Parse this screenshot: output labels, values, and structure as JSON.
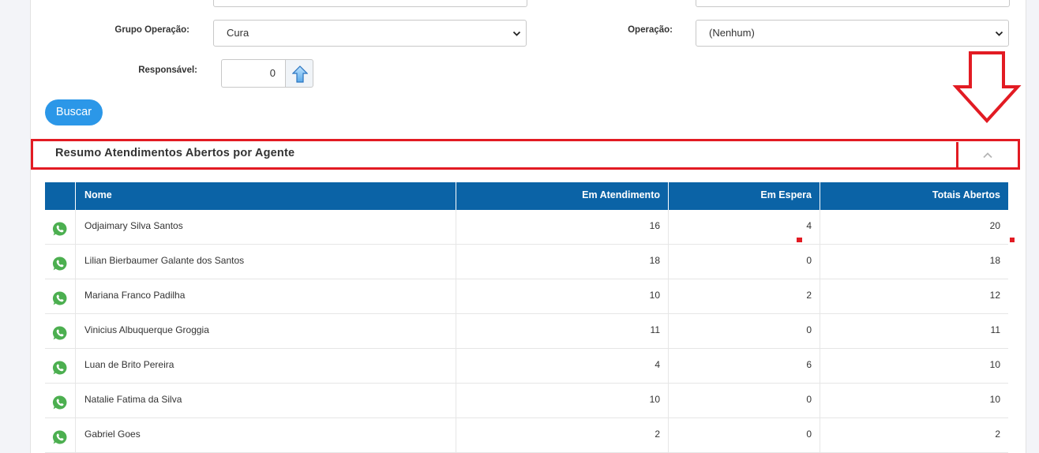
{
  "form": {
    "grupo_operacao": {
      "label": "Grupo Operação:",
      "value": "Cura"
    },
    "operacao": {
      "label": "Operação:",
      "value": "(Nenhum)"
    },
    "responsavel": {
      "label": "Responsável:",
      "value": "0"
    },
    "search_button": "Buscar"
  },
  "panel": {
    "title": "Resumo Atendimentos Abertos por Agente"
  },
  "colors": {
    "header_blue": "#0b63a6",
    "button_blue": "#2b97e8",
    "highlight_red": "#e21b23",
    "whatsapp_green": "#4caf50"
  },
  "table": {
    "headers": [
      "Nome",
      "Em Atendimento",
      "Em Espera",
      "Totais Abertos"
    ],
    "rows": [
      {
        "nome": "Odjaimary Silva Santos",
        "em_atendimento": "16",
        "em_espera": "4",
        "totais": "20"
      },
      {
        "nome": "Lilian Bierbaumer Galante dos Santos",
        "em_atendimento": "18",
        "em_espera": "0",
        "totais": "18"
      },
      {
        "nome": "Mariana Franco Padilha",
        "em_atendimento": "10",
        "em_espera": "2",
        "totais": "12"
      },
      {
        "nome": "Vinicius Albuquerque Groggia",
        "em_atendimento": "11",
        "em_espera": "0",
        "totais": "11"
      },
      {
        "nome": "Luan de Brito Pereira",
        "em_atendimento": "4",
        "em_espera": "6",
        "totais": "10"
      },
      {
        "nome": "Natalie Fatima da Silva",
        "em_atendimento": "10",
        "em_espera": "0",
        "totais": "10"
      },
      {
        "nome": "Gabriel Goes",
        "em_atendimento": "2",
        "em_espera": "0",
        "totais": "2"
      }
    ]
  },
  "icons": {
    "row_icon": "whatsapp-icon",
    "collapse_icon": "chevron-up-icon",
    "annotation": "arrow-down-icon",
    "responsavel_button": "arrow-up-icon"
  }
}
